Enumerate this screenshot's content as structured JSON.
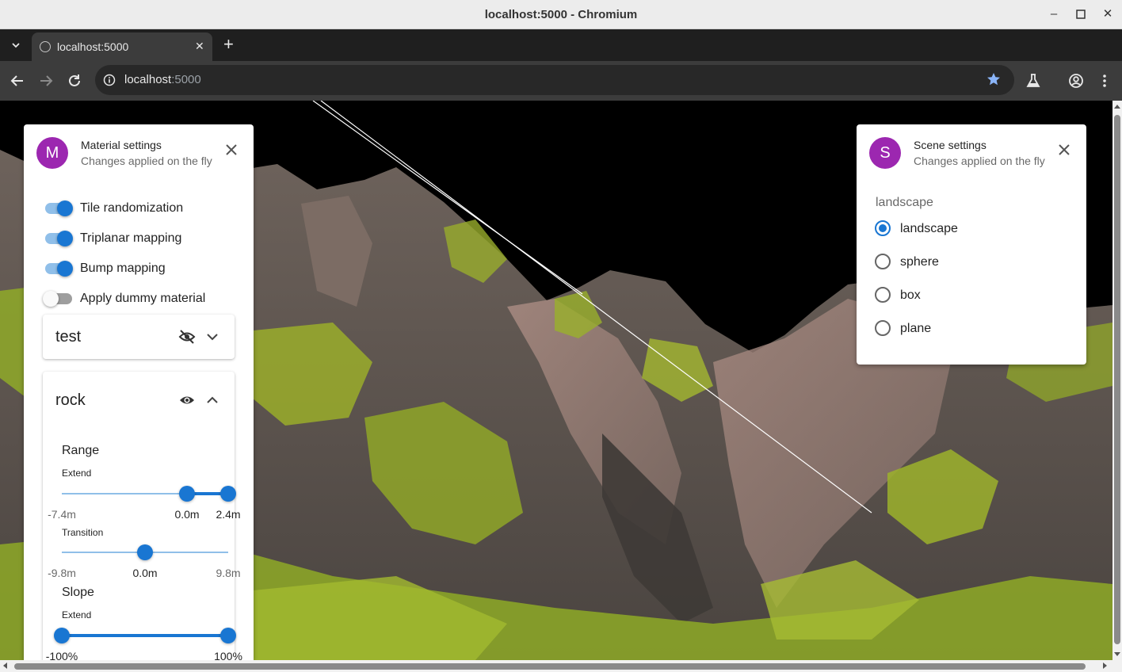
{
  "window": {
    "title": "localhost:5000 - Chromium"
  },
  "browser": {
    "tab_label": "localhost:5000",
    "url_host": "localhost",
    "url_port": ":5000"
  },
  "material_settings": {
    "avatar": "M",
    "title": "Material settings",
    "subtitle": "Changes applied on the fly",
    "switches": [
      {
        "label": "Tile randomization",
        "checked": true
      },
      {
        "label": "Triplanar mapping",
        "checked": true
      },
      {
        "label": "Bump mapping",
        "checked": true
      },
      {
        "label": "Apply dummy material",
        "checked": false
      }
    ],
    "layers": [
      {
        "name": "test",
        "visible": false,
        "expanded": false
      },
      {
        "name": "rock",
        "visible": true,
        "expanded": true,
        "range": {
          "title": "Range",
          "extend": {
            "label": "Extend",
            "min": "-7.4m",
            "low": "0.0m",
            "high": "2.4m",
            "min_value": -7.4,
            "max_value": 2.4,
            "low_value": 0.0,
            "high_value": 2.4
          },
          "transition": {
            "label": "Transition",
            "min": "-9.8m",
            "value": "0.0m",
            "max": "9.8m",
            "min_value": -9.8,
            "max_value": 9.8,
            "current_value": 0.0
          }
        },
        "slope": {
          "title": "Slope",
          "extend": {
            "label": "Extend",
            "min": "-100%",
            "max": "100%",
            "min_value": -100,
            "max_value": 100,
            "low_value": -100,
            "high_value": 100
          }
        }
      }
    ]
  },
  "scene_settings": {
    "avatar": "S",
    "title": "Scene settings",
    "subtitle": "Changes applied on the fly",
    "group_label": "landscape",
    "options": [
      {
        "label": "landscape",
        "checked": true
      },
      {
        "label": "sphere",
        "checked": false
      },
      {
        "label": "box",
        "checked": false
      },
      {
        "label": "plane",
        "checked": false
      }
    ]
  },
  "colors": {
    "accent": "#1976d2",
    "avatar": "#9c27b0",
    "terrain_rock": "#5e5650",
    "terrain_moss": "#9aad2a"
  }
}
